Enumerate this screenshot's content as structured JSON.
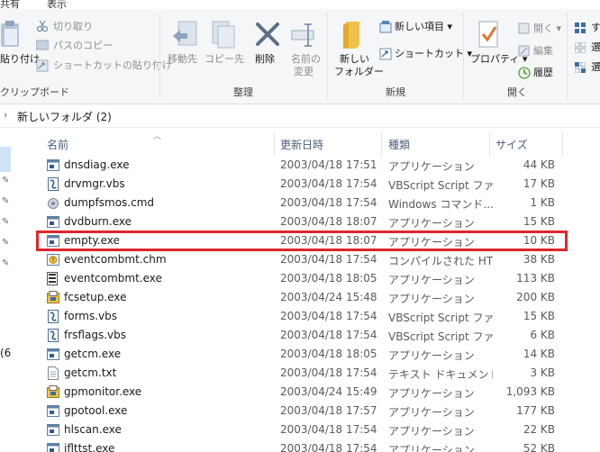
{
  "ribbon_tabs": [
    "共有",
    "表示"
  ],
  "clipboard": {
    "paste_label": "貼り付け",
    "cut_label": "切り取り",
    "copy_path_label": "パスのコピー",
    "paste_shortcut_label": "ショートカットの貼り付け",
    "group_label": "クリップボード"
  },
  "organize": {
    "move_label": "移動先",
    "copy_label": "コピー先",
    "delete_label": "削除",
    "rename_label_1": "名前の",
    "rename_label_2": "変更",
    "group_label": "整理"
  },
  "new": {
    "new_folder_label_1": "新しい",
    "new_folder_label_2": "フォルダー",
    "new_item_label": "新しい項目",
    "shortcut_label": "ショートカット",
    "group_label": "新規"
  },
  "open": {
    "properties_label": "プロパティ",
    "open_label": "開く",
    "edit_label": "編集",
    "history_label": "履歴",
    "group_label": "開く"
  },
  "select_fragments": [
    "す",
    "選",
    "選"
  ],
  "address": {
    "path": "新しいフォルダ (2)"
  },
  "nav_fragment": "(6",
  "columns": {
    "name": "名前",
    "date": "更新日時",
    "type": "種類",
    "size": "サイズ"
  },
  "files": [
    {
      "name": "dnsdiag.exe",
      "date": "2003/04/18 17:51",
      "type": "アプリケーション",
      "size": "44 KB",
      "icon": "exe"
    },
    {
      "name": "drvmgr.vbs",
      "date": "2003/04/18 17:54",
      "type": "VBScript Script ファ...",
      "size": "17 KB",
      "icon": "vbs"
    },
    {
      "name": "dumpfsmos.cmd",
      "date": "2003/04/18 17:54",
      "type": "Windows コマンド...",
      "size": "1 KB",
      "icon": "cmd"
    },
    {
      "name": "dvdburn.exe",
      "date": "2003/04/18 18:07",
      "type": "アプリケーション",
      "size": "15 KB",
      "icon": "exe"
    },
    {
      "name": "empty.exe",
      "date": "2003/04/18 18:07",
      "type": "アプリケーション",
      "size": "10 KB",
      "icon": "exe"
    },
    {
      "name": "eventcombmt.chm",
      "date": "2003/04/18 17:54",
      "type": "コンパイルされた HT...",
      "size": "38 KB",
      "icon": "chm"
    },
    {
      "name": "eventcombmt.exe",
      "date": "2003/04/18 18:05",
      "type": "アプリケーション",
      "size": "113 KB",
      "icon": "exe2"
    },
    {
      "name": "fcsetup.exe",
      "date": "2003/04/24 15:48",
      "type": "アプリケーション",
      "size": "200 KB",
      "icon": "setup"
    },
    {
      "name": "forms.vbs",
      "date": "2003/04/18 17:54",
      "type": "VBScript Script ファ...",
      "size": "15 KB",
      "icon": "vbs"
    },
    {
      "name": "frsflags.vbs",
      "date": "2003/04/18 17:54",
      "type": "VBScript Script ファ...",
      "size": "6 KB",
      "icon": "vbs"
    },
    {
      "name": "getcm.exe",
      "date": "2003/04/18 18:05",
      "type": "アプリケーション",
      "size": "14 KB",
      "icon": "exe"
    },
    {
      "name": "getcm.txt",
      "date": "2003/04/18 17:54",
      "type": "テキスト ドキュメント",
      "size": "3 KB",
      "icon": "txt"
    },
    {
      "name": "gpmonitor.exe",
      "date": "2003/04/24 15:49",
      "type": "アプリケーション",
      "size": "1,093 KB",
      "icon": "setup"
    },
    {
      "name": "gpotool.exe",
      "date": "2003/04/18 17:57",
      "type": "アプリケーション",
      "size": "177 KB",
      "icon": "exe"
    },
    {
      "name": "hlscan.exe",
      "date": "2003/04/18 17:54",
      "type": "アプリケーション",
      "size": "22 KB",
      "icon": "exe"
    },
    {
      "name": "iflttst.exe",
      "date": "2003/04/18 17:54",
      "type": "アプリケーション",
      "size": "52 KB",
      "icon": "exe"
    }
  ],
  "highlighted_file": "empty.exe",
  "colors": {
    "highlight": "#e0252c",
    "ribbon_bg": "#f5f6f7",
    "header_text": "#4c607a"
  }
}
